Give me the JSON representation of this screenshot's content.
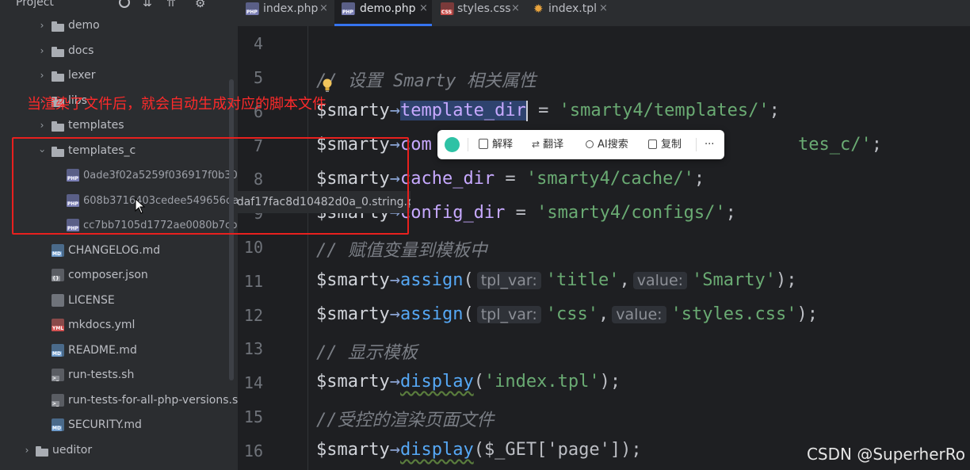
{
  "sidebar": {
    "header_label": "Project",
    "items": [
      {
        "label": "demo",
        "kind": "folder",
        "expanded": false
      },
      {
        "label": "docs",
        "kind": "folder",
        "expanded": false
      },
      {
        "label": "lexer",
        "kind": "folder",
        "expanded": false
      },
      {
        "label": "libs",
        "kind": "folder",
        "expanded": false
      },
      {
        "label": "templates",
        "kind": "folder",
        "expanded": false
      },
      {
        "label": "templates_c",
        "kind": "folder",
        "expanded": true
      },
      {
        "label": "0ade3f02a5259f036917f0b30",
        "kind": "php"
      },
      {
        "label": "608b3716403cedee549656daf17fac8d10482d0a_0.string.php",
        "kind": "php"
      },
      {
        "label": "cc7bb7105d1772ae0080b7cb",
        "kind": "php"
      },
      {
        "label": "CHANGELOG.md",
        "kind": "md"
      },
      {
        "label": "composer.json",
        "kind": "json"
      },
      {
        "label": "LICENSE",
        "kind": "text"
      },
      {
        "label": "mkdocs.yml",
        "kind": "yml"
      },
      {
        "label": "README.md",
        "kind": "md"
      },
      {
        "label": "run-tests.sh",
        "kind": "sh"
      },
      {
        "label": "run-tests-for-all-php-versions.sh",
        "kind": "sh"
      },
      {
        "label": "SECURITY.md",
        "kind": "md"
      },
      {
        "label": "ueditor",
        "kind": "folder",
        "expanded": false
      }
    ]
  },
  "tabs": [
    {
      "label": "index.php",
      "icon": "php-file-icon",
      "active": false
    },
    {
      "label": "demo.php",
      "icon": "php-file-icon",
      "active": true
    },
    {
      "label": "styles.css",
      "icon": "css-file-icon",
      "active": false
    },
    {
      "label": "index.tpl",
      "icon": "tpl-file-icon",
      "active": false
    }
  ],
  "tab_close": "×",
  "gutter": [
    "4",
    "5",
    "6",
    "7",
    "8",
    "9",
    "10",
    "11",
    "12",
    "13",
    "14",
    "15",
    "16"
  ],
  "code": {
    "var": "$smarty",
    "arrow": "→",
    "l5_comment": "// 设置 Smarty 相关属性",
    "l6_prop": "template_dir",
    "l6_eq": " = ",
    "l6_str": "'smarty4/templates/'",
    "semi": ";",
    "l7_prop_visible": "com",
    "l7_str_visible": "tes_c/'",
    "l8_prop": "cache_dir",
    "l8_str": "'smarty4/cache/'",
    "l9_var_visible": "$smarty",
    "l9_prop": "config_dir",
    "l9_str": "'smarty4/configs/'",
    "l10_comment": "// 赋值变量到模板中",
    "assign": "assign",
    "open_paren": "(",
    "close_paren": ")",
    "comma": ",",
    "hint_tpl_var": "tpl_var:",
    "hint_value": "value:",
    "l11_arg1": "'title'",
    "l11_arg2": "'Smarty'",
    "l12_arg1": "'css'",
    "l12_arg2": "'styles.css'",
    "l13_comment": "// 显示模板",
    "display": "display",
    "l14_arg": "'index.tpl'",
    "l15_comment": "//受控的渲染页面文件",
    "l16_arg": "$_GET['page']"
  },
  "floating_toolbar": {
    "items": [
      {
        "label": "解释",
        "icon": "explain-icon"
      },
      {
        "label": "翻译",
        "icon": "translate-icon"
      },
      {
        "label": "AI搜索",
        "icon": "search-icon"
      },
      {
        "label": "复制",
        "icon": "copy-icon"
      },
      {
        "label": "···",
        "icon": "more-icon"
      }
    ]
  },
  "annotation": "当渲染了文件后，就会自动生成对应的脚本文件",
  "tooltip": "608b3716403cedee549656daf17fac8d10482d0a_0.string.php",
  "watermark": "CSDN @SuperherRo",
  "colors": {
    "accent": "#3574f0",
    "annotation_red": "#e8201e",
    "string_green": "#6aab73",
    "function_blue": "#56a8f5",
    "property_purple": "#c7a9ff"
  }
}
